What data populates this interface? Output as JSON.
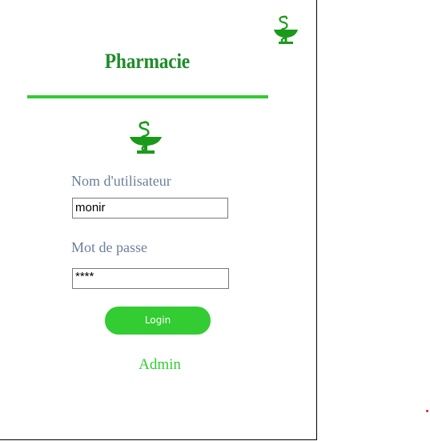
{
  "app": {
    "title": "Pharmacie",
    "logo_icon": "bowl-of-hygieia-icon"
  },
  "login_form": {
    "username_label": "Nom d'utilisateur",
    "username_value": "monir",
    "password_label": "Mot de passe",
    "password_value": "****",
    "login_button": "Login",
    "admin_link": "Admin"
  },
  "colors": {
    "brand_green": "#33cc33",
    "title_green": "#1e8c2a",
    "logo_green": "#1a9a1a",
    "label_gray": "#6b7f9a"
  }
}
